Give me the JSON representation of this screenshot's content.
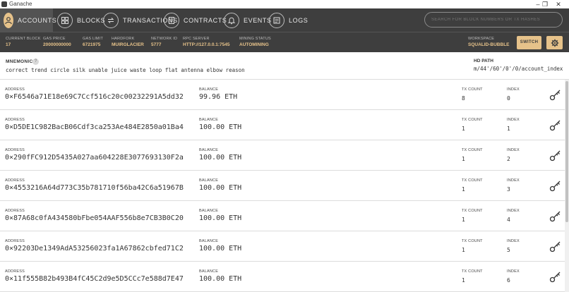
{
  "window": {
    "title": "Ganache",
    "minimize": "–",
    "maximize": "❐",
    "close": "✕"
  },
  "nav": {
    "accounts": "ACCOUNTS",
    "blocks": "BLOCKS",
    "transactions": "TRANSACTIONS",
    "contracts": "CONTRACTS",
    "events": "EVENTS",
    "logs": "LOGS"
  },
  "search": {
    "placeholder": "SEARCH FOR BLOCK NUMBERS OR TX HASHES"
  },
  "status": {
    "current_block": {
      "label": "CURRENT BLOCK",
      "value": "17"
    },
    "gas_price": {
      "label": "GAS PRICE",
      "value": "20000000000"
    },
    "gas_limit": {
      "label": "GAS LIMIT",
      "value": "6721975"
    },
    "hardfork": {
      "label": "HARDFORK",
      "value": "MUIRGLACIER"
    },
    "network_id": {
      "label": "NETWORK ID",
      "value": "5777"
    },
    "rpc_server": {
      "label": "RPC SERVER",
      "value": "HTTP://127.0.0.1:7545"
    },
    "mining_status": {
      "label": "MINING STATUS",
      "value": "AUTOMINING"
    },
    "workspace": {
      "label": "WORKSPACE",
      "value": "SQUALID-BUBBLE"
    },
    "switch_label": "SWITCH"
  },
  "mnemonic": {
    "label": "MNEMONIC",
    "help": "?",
    "words": "correct trend circle silk unable juice waste loop flat antenna elbow reason",
    "hd_path_label": "HD PATH",
    "hd_path": "m/44'/60'/0'/0/account_index"
  },
  "labels": {
    "address": "ADDRESS",
    "balance": "BALANCE",
    "tx_count": "TX COUNT",
    "index": "INDEX"
  },
  "accounts": [
    {
      "address": "0×F6546a71E18e69C7Ccf516c20c00232291A5dd32",
      "balance": "99.96  ETH",
      "tx_count": "8",
      "index": "0"
    },
    {
      "address": "0×D5DE1C982BacB06Cdf3ca253Ae484E2850a01Ba4",
      "balance": "100.00  ETH",
      "tx_count": "1",
      "index": "1"
    },
    {
      "address": "0×290fFC912D5435A027aa604228E3077693130F2a",
      "balance": "100.00  ETH",
      "tx_count": "1",
      "index": "2"
    },
    {
      "address": "0×4553216A64d773C35b781710f56ba42C6a51967B",
      "balance": "100.00  ETH",
      "tx_count": "1",
      "index": "3"
    },
    {
      "address": "0×87A68c0fA434580bFbe054AAF556b8e7CB3B0C20",
      "balance": "100.00  ETH",
      "tx_count": "1",
      "index": "4"
    },
    {
      "address": "0×92203De1349AdA53256023fa1A67862cbfed71C2",
      "balance": "100.00  ETH",
      "tx_count": "1",
      "index": "5"
    },
    {
      "address": "0×11f555B82b493B4fC45C2d9e5D5CCc7e588d7E47",
      "balance": "100.00  ETH",
      "tx_count": "1",
      "index": "6"
    }
  ],
  "colors": {
    "accent": "#e6c28a",
    "nav_bg": "#3e3e3e",
    "text": "#333333"
  }
}
